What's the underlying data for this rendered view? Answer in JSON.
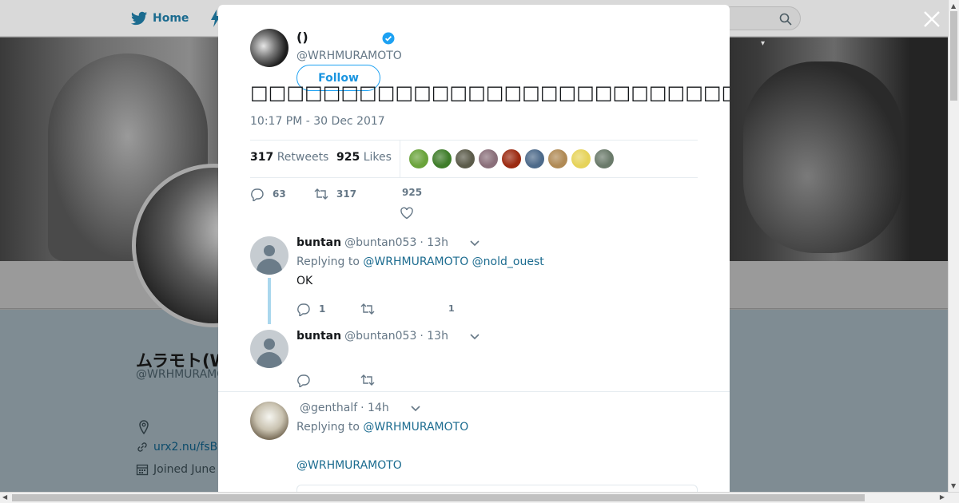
{
  "nav": {
    "home_label": "Home"
  },
  "profile": {
    "name": "ムラモト(WRHMURAMOTO)",
    "handle": "@WRHMURAMOTO",
    "link": "urx2.nu/fsB",
    "joined": "Joined June"
  },
  "tweet": {
    "author_name": "()",
    "author_handle": "@WRHMURAMOTO",
    "follow_label": "Follow",
    "text": "□□□□□□□□□□□□□□□□□□□□□□□□□□□□□□□□□□□□□□□□□□□□□□□□□□□□□□□□□□□□",
    "time": "10:17 PM - 30 Dec 2017",
    "retweets_count": "317",
    "retweets_label": "Retweets",
    "likes_count": "925",
    "likes_label": "Likes",
    "likers": [
      "#6aa33b",
      "#3f7d2a",
      "#5b5b4a",
      "#8a6f7a",
      "#9c2b12",
      "#4d6a8a",
      "#b08a55",
      "#e6d35a",
      "#6a7a6a"
    ],
    "actions": {
      "replies": "63",
      "retweets": "317",
      "likes": "925"
    }
  },
  "replies": [
    {
      "name": "buntan",
      "handle": "@buntan053",
      "time": "· 13h",
      "replying_prefix": "Replying to",
      "mentions": "@WRHMURAMOTO @nold_ouest",
      "body": "OK",
      "reply_count": "1",
      "like_count": "1"
    },
    {
      "name": "buntan",
      "handle": "@buntan053",
      "time": "· 13h"
    },
    {
      "name": "",
      "handle": "@genthalf",
      "time": "· 14h",
      "replying_prefix": "Replying to",
      "mentions": "@WRHMURAMOTO",
      "body_mention": "@WRHMURAMOTO"
    }
  ],
  "colors": {
    "accent": "#1da1f2",
    "link": "#1b6b8f",
    "muted": "#657786"
  }
}
